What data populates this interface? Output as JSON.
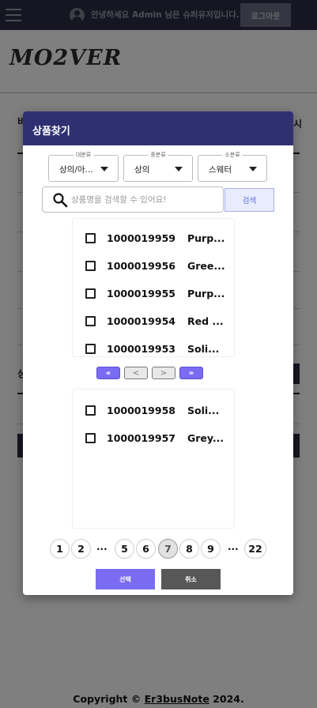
{
  "topbar": {
    "menu_icon": "hamburger-icon",
    "user_icon": "user-circle-icon",
    "greeting": "안녕하세요 Admin 님은 슈퍼유저입니다.",
    "logout_label": "로그아웃"
  },
  "brand": {
    "logo_text": "MO2VER"
  },
  "background": {
    "left_edge_text": "비",
    "right_edge_text": "시",
    "lower_left_text": "상"
  },
  "modal": {
    "title": "상품찾기",
    "filters": [
      {
        "legend": "대분류",
        "value": "상의/아..."
      },
      {
        "legend": "중분류",
        "value": "상의"
      },
      {
        "legend": "소분류",
        "value": "스웨터"
      }
    ],
    "search": {
      "placeholder": "상품명을 검색할 수 있어요!",
      "value": "",
      "button_label": "검색",
      "icon": "search-icon"
    },
    "product_list": [
      {
        "id": "1000019959",
        "name": "Purp...",
        "checked": false
      },
      {
        "id": "1000019956",
        "name": "Gree...",
        "checked": false
      },
      {
        "id": "1000019955",
        "name": "Purp...",
        "checked": false
      },
      {
        "id": "1000019954",
        "name": "Red ...",
        "checked": false
      },
      {
        "id": "1000019953",
        "name": "Soli...",
        "checked": false
      }
    ],
    "transfer_controls": {
      "move_all_right": "«",
      "move_right": "<",
      "move_left": ">",
      "move_all_left": "»"
    },
    "selected_list": [
      {
        "id": "1000019958",
        "name": "Soli...",
        "checked": false
      },
      {
        "id": "1000019957",
        "name": "Grey...",
        "checked": false
      }
    ],
    "pagination": {
      "pages": [
        "1",
        "2",
        "...",
        "5",
        "6",
        "7",
        "8",
        "9",
        "...",
        "22"
      ],
      "current": "7"
    },
    "select_label": "선택",
    "cancel_label": "취소",
    "colors": {
      "header": "#2f3072",
      "accent": "#7a6cf2",
      "cancel": "#575757"
    }
  },
  "footer": {
    "prefix": "Copyright © ",
    "link_text": "Er3busNote",
    "suffix": " 2024."
  }
}
